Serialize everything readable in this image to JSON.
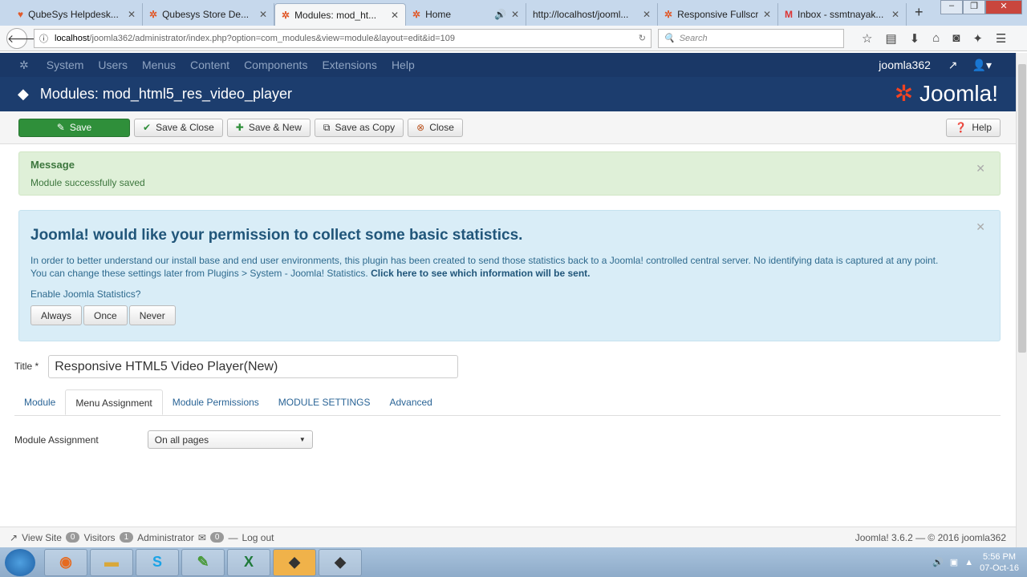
{
  "browser": {
    "tabs": [
      {
        "title": "QubeSys Helpdesk..."
      },
      {
        "title": "Qubesys Store De..."
      },
      {
        "title": "Modules: mod_ht...",
        "active": true
      },
      {
        "title": "Home"
      },
      {
        "title": "http://localhost/jooml..."
      },
      {
        "title": "Responsive Fullscr..."
      },
      {
        "title": "Inbox - ssmtnayak..."
      }
    ],
    "url_host": "localhost",
    "url_path": "/joomla362/administrator/index.php?option=com_modules&view=module&layout=edit&id=109",
    "search_placeholder": "Search"
  },
  "menu": [
    "System",
    "Users",
    "Menus",
    "Content",
    "Components",
    "Extensions",
    "Help"
  ],
  "user": "joomla362",
  "header": {
    "title": "Modules: mod_html5_res_video_player",
    "logo": "Joomla!"
  },
  "toolbar": {
    "save": "Save",
    "save_close": "Save & Close",
    "save_new": "Save & New",
    "save_copy": "Save as Copy",
    "close": "Close",
    "help": "Help"
  },
  "message": {
    "heading": "Message",
    "text": "Module successfully saved"
  },
  "stats": {
    "heading": "Joomla! would like your permission to collect some basic statistics.",
    "line1": "In order to better understand our install base and end user environments, this plugin has been created to send those statistics back to a Joomla! controlled central server. No identifying data is captured at any point.",
    "line2": "You can change these settings later from Plugins > System - Joomla! Statistics.",
    "link": "Click here to see which information will be sent.",
    "question": "Enable Joomla Statistics?",
    "always": "Always",
    "once": "Once",
    "never": "Never"
  },
  "form": {
    "title_label": "Title *",
    "title_value": "Responsive HTML5 Video Player(New)",
    "tabs": [
      "Module",
      "Menu Assignment",
      "Module Permissions",
      "MODULE SETTINGS",
      "Advanced"
    ],
    "active_tab": "Menu Assignment",
    "assignment_label": "Module Assignment",
    "assignment_value": "On all pages"
  },
  "status": {
    "view_site": "View Site",
    "visitors_count": "0",
    "visitors": "Visitors",
    "admin_count": "1",
    "admin": "Administrator",
    "messages_count": "0",
    "logout": "Log out",
    "version": "Joomla! 3.6.2 — © 2016 joomla362"
  },
  "taskbar": {
    "time": "5:56 PM",
    "date": "07-Oct-16"
  }
}
